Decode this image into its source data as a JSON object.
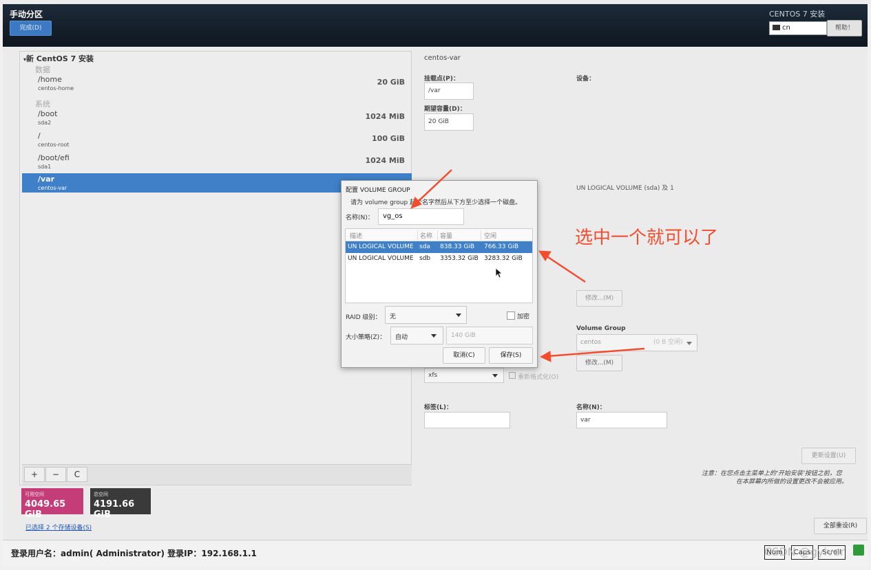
{
  "header": {
    "title": "手动分区",
    "done_button": "完成(D)",
    "product_title": "CENTOS 7 安装",
    "keyboard": "cn",
    "help_button": "帮助！"
  },
  "left_panel": {
    "group_title": "新 CentOS 7 安装",
    "category_data": "数据",
    "category_system": "系统",
    "rows": [
      {
        "mount": "/home",
        "device": "centos-home",
        "size": "20 GiB"
      },
      {
        "mount": "/boot",
        "device": "sda2",
        "size": "1024 MiB"
      },
      {
        "mount": "/",
        "device": "centos-root",
        "size": "100 GiB"
      },
      {
        "mount": "/boot/efi",
        "device": "sda1",
        "size": "1024 MiB"
      },
      {
        "mount": "/var",
        "device": "centos-var",
        "size": "20 GiB"
      }
    ],
    "toolbar": {
      "add": "+",
      "remove": "−",
      "refresh": "C"
    },
    "available_label": "可用空间",
    "available_value": "4049.65 GiB",
    "total_label": "总空间",
    "total_value": "4191.66 GiB",
    "selected_link": "已选择 2 个存储设备(S)"
  },
  "right_panel": {
    "title": "centos-var",
    "mount_label": "挂载点(P)：",
    "mount_value": "/var",
    "capacity_label": "期望容量(D)：",
    "capacity_value": "20 GiB",
    "device_label": "设备：",
    "device_value": "UN LOGICAL VOLUME (sda) 及 1",
    "modify_button_1": "修改...(M)",
    "vg_label": "Volume Group",
    "vg_value": "centos",
    "vg_free": "(0 B 空闲)",
    "modify_button_2": "修改...(M)",
    "fs_value": "xfs",
    "reformat_label": "重新格式化(O)",
    "tag_label": "标签(L)：",
    "tag_value": "",
    "name_label": "名称(N)：",
    "name_value": "var",
    "update_button": "更新设置(U)",
    "note_line1": "注意：在您点击主菜单上的‘开始安装’按钮之前，您",
    "note_line2": "在本屏幕内所做的设置更改不会被应用。",
    "reset_all_button": "全部重设(R)"
  },
  "dialog": {
    "title": "配置 VOLUME GROUP",
    "hint": "请为 volume group 起个名字然后从下方至少选择一个磁盘。",
    "name_label": "名称(N)：",
    "name_value": "vg_os",
    "columns": [
      "描述",
      "名称",
      "容量",
      "空闲"
    ],
    "rows": [
      {
        "desc": "UN LOGICAL VOLUME",
        "name": "sda",
        "capacity": "838.33 GiB",
        "free": "766.33 GiB",
        "selected": true
      },
      {
        "desc": "UN LOGICAL VOLUME",
        "name": "sdb",
        "capacity": "3353.32 GiB",
        "free": "3283.32 GiB",
        "selected": false
      }
    ],
    "raid_label": "RAID 级别：",
    "raid_value": "无",
    "encrypt_label": "加密",
    "size_policy_label": "大小策略(Z)：",
    "size_policy_value": "自动",
    "size_value": "140 GiB",
    "cancel_button": "取消(C)",
    "save_button": "保存(S)"
  },
  "status_bar": {
    "text": "登录用户名：admin( Administrator)   登录IP：192.168.1.1",
    "keys": [
      "Num",
      "Caps",
      "Scroll"
    ],
    "watermark": "CSDN @gyivar"
  },
  "annotation": {
    "text": "选中一个就可以了",
    "color": "#f34d2f"
  },
  "colors": {
    "selection": "#3f80c8",
    "available": "#c43d78",
    "total": "#3a3a3a",
    "header": "#16202c"
  }
}
